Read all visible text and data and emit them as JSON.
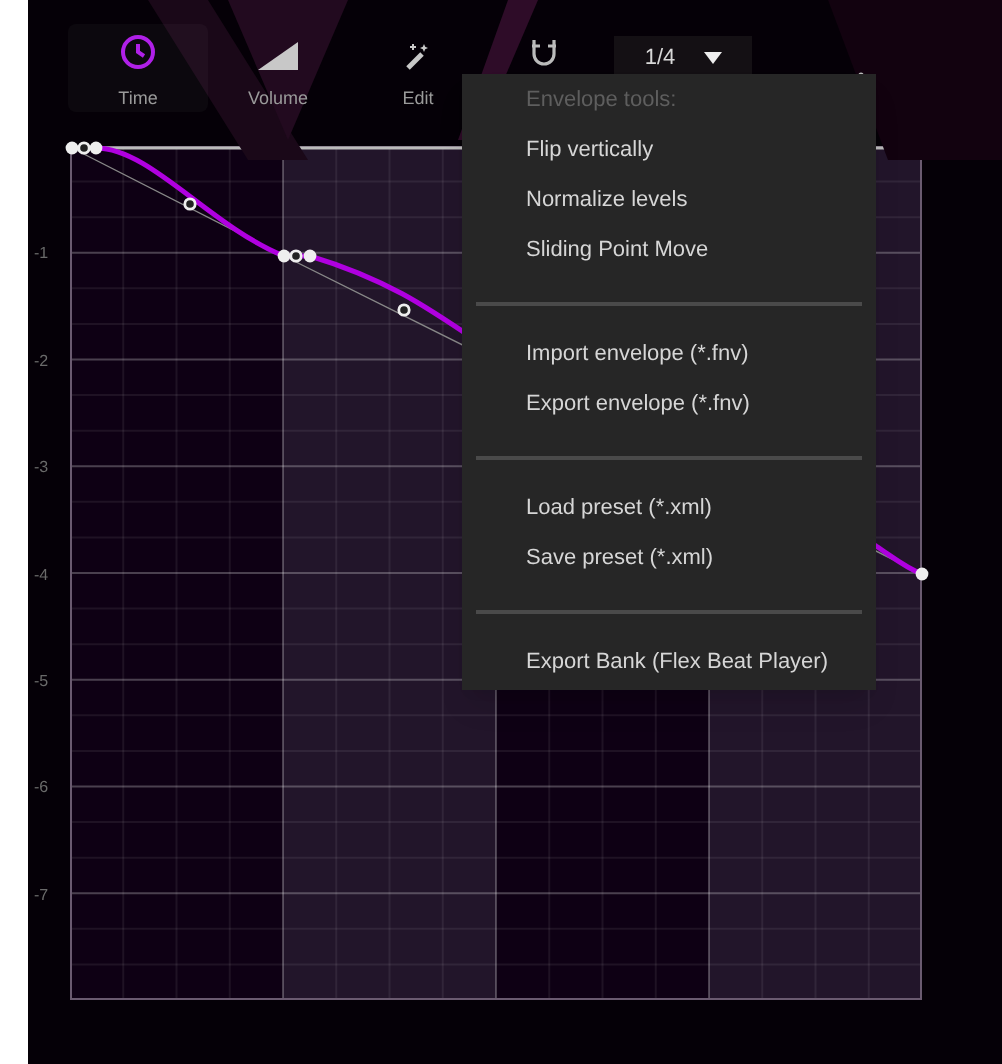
{
  "toolbar": {
    "tools": [
      {
        "kind": "clock",
        "label": "Time",
        "selected": true
      },
      {
        "kind": "ramp",
        "label": "Volume",
        "selected": false
      },
      {
        "kind": "wand",
        "label": "Edit",
        "selected": false
      }
    ],
    "grid_dropdown": {
      "value": "1/4"
    }
  },
  "graph": {
    "y_labels": [
      "-1",
      "-2",
      "-3",
      "-4",
      "-5",
      "-6",
      "-7"
    ]
  },
  "menu": {
    "items": [
      {
        "kind": "header",
        "label": "Envelope tools:"
      },
      {
        "kind": "item",
        "label": "Flip vertically"
      },
      {
        "kind": "item",
        "label": "Normalize levels"
      },
      {
        "kind": "item",
        "label": "Sliding Point Move"
      },
      {
        "kind": "separator"
      },
      {
        "kind": "item",
        "label": "Import envelope (*.fnv)"
      },
      {
        "kind": "item",
        "label": "Export envelope (*.fnv)"
      },
      {
        "kind": "separator"
      },
      {
        "kind": "item",
        "label": "Load preset (*.xml)"
      },
      {
        "kind": "item",
        "label": "Save preset (*.xml)"
      },
      {
        "kind": "separator"
      },
      {
        "kind": "item",
        "label": "Export Bank (Flex Beat Player)"
      }
    ]
  }
}
